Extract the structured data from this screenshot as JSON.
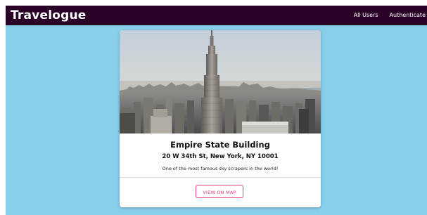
{
  "navbar": {
    "brand": "Travelogue",
    "links": [
      "All Users",
      "Authenticate"
    ]
  },
  "place": {
    "name": "Empire State Building",
    "address": "20 W 34th St, New York, NY 10001",
    "description": "One of the most famous sky scrapers in the world!",
    "button_label": "VIEW ON MAP"
  },
  "colors": {
    "navbar_bg": "#2a0127",
    "page_bg": "#88cfea",
    "accent": "#e5407a"
  }
}
